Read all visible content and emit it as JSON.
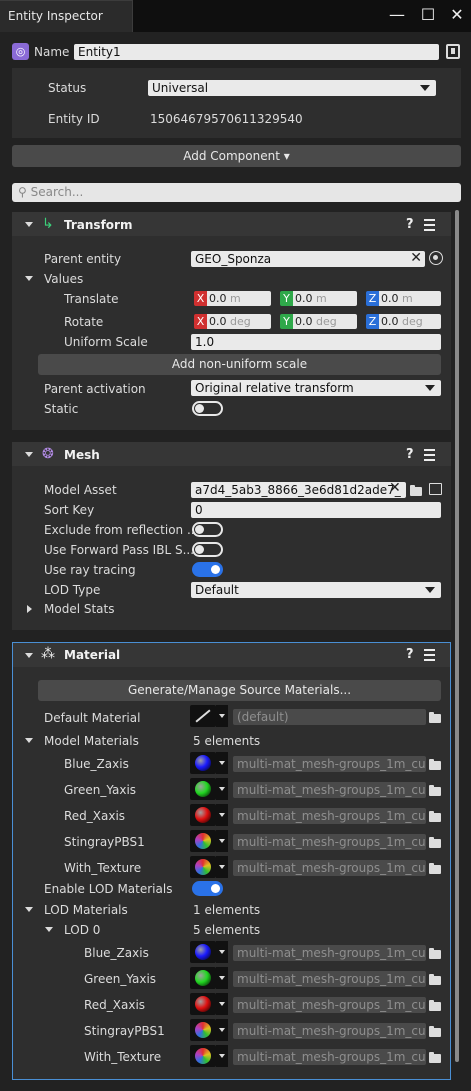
{
  "window": {
    "tab_title": "Entity Inspector",
    "minimize": "—",
    "maximize": "☐",
    "close": "✕"
  },
  "header": {
    "name_label": "Name",
    "name_value": "Entity1",
    "status_label": "Status",
    "status_value": "Universal",
    "entity_id_label": "Entity ID",
    "entity_id_value": "15064679570611329540",
    "add_component": "Add Component ▾",
    "search_placeholder": "Search..."
  },
  "transform": {
    "title": "Transform",
    "help": "?",
    "parent_entity_label": "Parent entity",
    "parent_entity_value": "GEO_Sponza",
    "values_label": "Values",
    "translate_label": "Translate",
    "rotate_label": "Rotate",
    "uniform_scale_label": "Uniform Scale",
    "uniform_scale_value": "1.0",
    "translate": {
      "x": "0.0",
      "y": "0.0",
      "z": "0.0",
      "unit": "m"
    },
    "rotate": {
      "x": "0.0",
      "y": "0.0",
      "z": "0.0",
      "unit": "deg"
    },
    "axis_x": "X",
    "axis_y": "Y",
    "axis_z": "Z",
    "add_nonuniform": "Add non-uniform scale",
    "parent_activation_label": "Parent activation",
    "parent_activation_value": "Original relative transform",
    "static_label": "Static"
  },
  "mesh": {
    "title": "Mesh",
    "help": "?",
    "model_asset_label": "Model Asset",
    "model_asset_value": "a7d4_5ab3_8866_3e6d81d2ade7_",
    "sort_key_label": "Sort Key",
    "sort_key_value": "0",
    "exclude_reflection_label": "Exclude from reflection ...",
    "forward_ibl_label": "Use Forward Pass IBL S...",
    "ray_tracing_label": "Use ray tracing",
    "lod_type_label": "LOD Type",
    "lod_type_value": "Default",
    "model_stats_label": "Model Stats"
  },
  "material": {
    "title": "Material",
    "help": "?",
    "generate_button": "Generate/Manage Source Materials...",
    "default_material_label": "Default Material",
    "default_material_value": "(default)",
    "model_materials_label": "Model Materials",
    "model_materials_count": "5 elements",
    "model_materials": [
      {
        "name": "Blue_Zaxis",
        "value": "multi-mat_mesh-groups_1m_cu...",
        "color": "#1a1aff"
      },
      {
        "name": "Green_Yaxis",
        "value": "multi-mat_mesh-groups_1m_cu...",
        "color": "#22d822"
      },
      {
        "name": "Red_Xaxis",
        "value": "multi-mat_mesh-groups_1m_cu...",
        "color": "#e01010"
      },
      {
        "name": "StingrayPBS1",
        "value": "multi-mat_mesh-groups_1m_cu...",
        "color": "#b08020"
      },
      {
        "name": "With_Texture",
        "value": "multi-mat_mesh-groups_1m_cu...",
        "color": "#9050c0"
      }
    ],
    "enable_lod_label": "Enable LOD Materials",
    "lod_materials_label": "LOD Materials",
    "lod_materials_count": "1 elements",
    "lod0_label": "LOD 0",
    "lod0_count": "5 elements",
    "lod0_materials": [
      {
        "name": "Blue_Zaxis",
        "value": "multi-mat_mesh-groups_1m_cu...",
        "color": "#1a1aff"
      },
      {
        "name": "Green_Yaxis",
        "value": "multi-mat_mesh-groups_1m_cu...",
        "color": "#22d822"
      },
      {
        "name": "Red_Xaxis",
        "value": "multi-mat_mesh-groups_1m_cu...",
        "color": "#e01010"
      },
      {
        "name": "StingrayPBS1",
        "value": "multi-mat_mesh-groups_1m_cu...",
        "color": "#b08020"
      },
      {
        "name": "With_Texture",
        "value": "multi-mat_mesh-groups_1m_cu...",
        "color": "#9050c0"
      }
    ]
  }
}
